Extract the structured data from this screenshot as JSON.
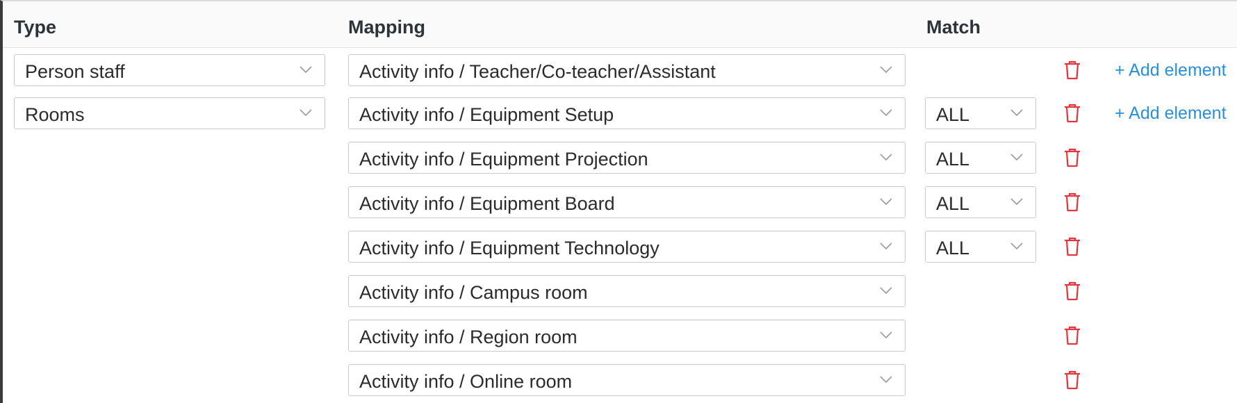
{
  "header": {
    "type_label": "Type",
    "mapping_label": "Mapping",
    "match_label": "Match"
  },
  "icons": {
    "dropdown": "chevron-down-icon",
    "delete": "trash-icon"
  },
  "colors": {
    "delete": "#e0353b",
    "link": "#2a8fd6"
  },
  "add_element_label": "+ Add element",
  "rows": [
    {
      "type": "Person staff",
      "mapping": "Activity info / Teacher/Co-teacher/Assistant",
      "match": "",
      "has_add": true
    },
    {
      "type": "Rooms",
      "mapping": "Activity info / Equipment Setup",
      "match": "ALL",
      "has_add": true
    },
    {
      "type": "",
      "mapping": "Activity info / Equipment Projection",
      "match": "ALL",
      "has_add": false
    },
    {
      "type": "",
      "mapping": "Activity info / Equipment Board",
      "match": "ALL",
      "has_add": false
    },
    {
      "type": "",
      "mapping": "Activity info / Equipment Technology",
      "match": "ALL",
      "has_add": false
    },
    {
      "type": "",
      "mapping": "Activity info / Campus room",
      "match": "",
      "has_add": false
    },
    {
      "type": "",
      "mapping": "Activity info / Region room",
      "match": "",
      "has_add": false
    },
    {
      "type": "",
      "mapping": "Activity info / Online room",
      "match": "",
      "has_add": false
    }
  ]
}
